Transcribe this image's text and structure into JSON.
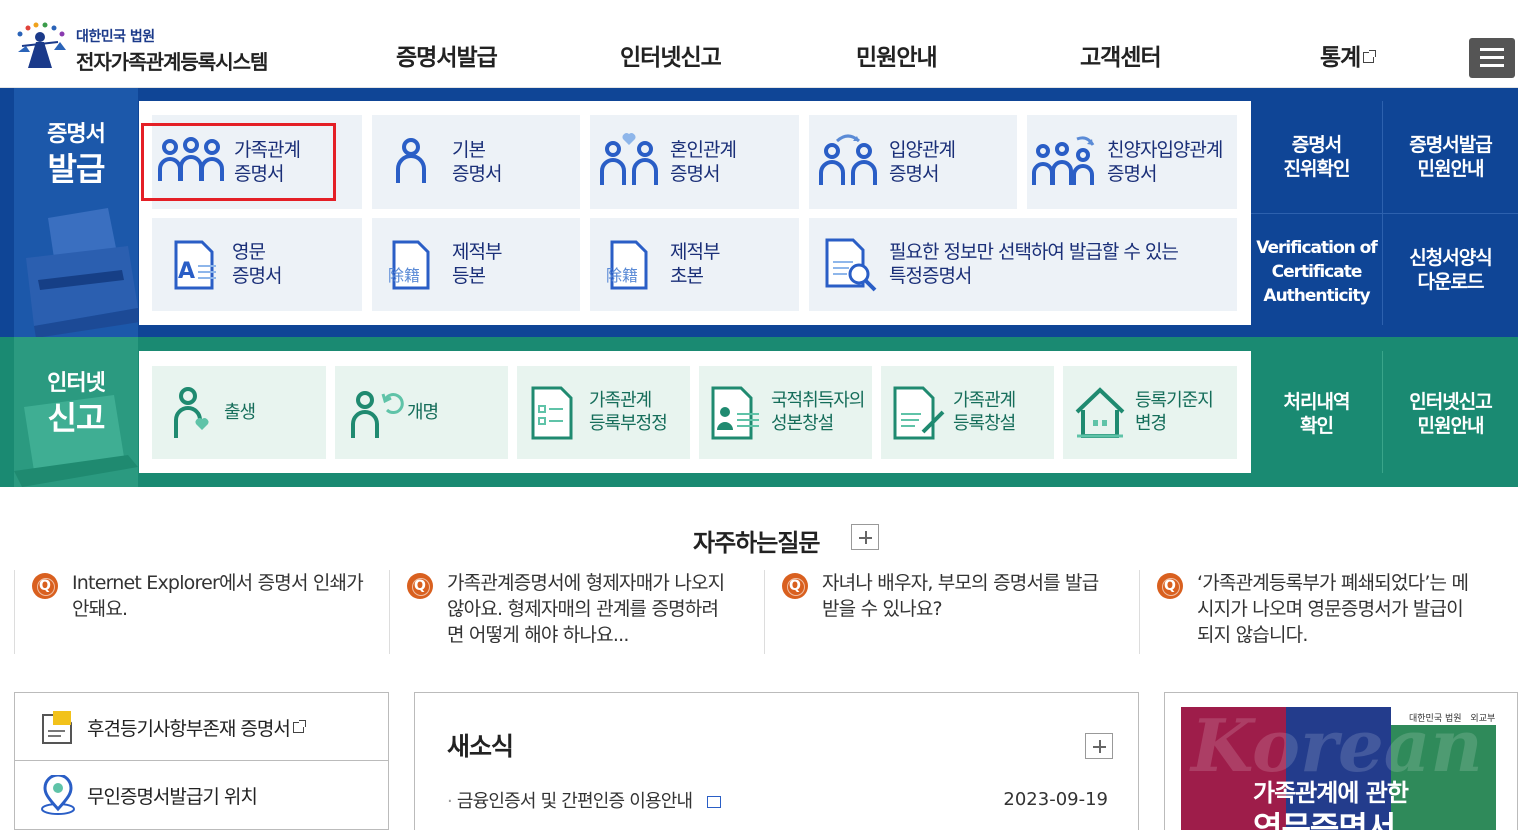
{
  "header": {
    "org_name": "대한민국 법원",
    "site_name": "전자가족관계등록시스템",
    "nav": [
      "증명서발급",
      "인터넷신고",
      "민원안내",
      "고객센터",
      "통계"
    ]
  },
  "cert": {
    "section_small": "증명서",
    "section_big": "발급",
    "tiles": [
      {
        "line1": "가족관계",
        "line2": "증명서",
        "icon": "family-icon"
      },
      {
        "line1": "기본",
        "line2": "증명서",
        "icon": "person-icon"
      },
      {
        "line1": "혼인관계",
        "line2": "증명서",
        "icon": "couple-heart-icon"
      },
      {
        "line1": "입양관계",
        "line2": "증명서",
        "icon": "adoption-icon"
      },
      {
        "line1": "친양자입양관계",
        "line2": "증명서",
        "icon": "family-adoption-icon"
      },
      {
        "line1": "영문",
        "line2": "증명서",
        "icon": "english-document-icon"
      },
      {
        "line1": "제적부",
        "line2": "등본",
        "icon": "document-icon"
      },
      {
        "line1": "제적부",
        "line2": "초본",
        "icon": "document-icon"
      },
      {
        "line1": "필요한 정보만 선택하여 발급할 수 있는",
        "line2": "특정증명서",
        "icon": "search-document-icon"
      }
    ],
    "doc_stamp": "除籍",
    "english_letter": "A",
    "side": [
      {
        "line1": "증명서",
        "line2": "진위확인",
        "line3": ""
      },
      {
        "line1": "증명서발급",
        "line2": "민원안내",
        "line3": ""
      },
      {
        "line1": "Verification of",
        "line2": "Certificate",
        "line3": "Authenticity"
      },
      {
        "line1": "신청서양식",
        "line2": "다운로드",
        "line3": ""
      }
    ]
  },
  "report": {
    "section_small": "인터넷",
    "section_big": "신고",
    "tiles": [
      {
        "line1": "출생",
        "line2": "",
        "icon": "birth-icon"
      },
      {
        "line1": "개명",
        "line2": "",
        "icon": "rename-icon"
      },
      {
        "line1": "가족관계",
        "line2": "등록부정정",
        "icon": "checklist-icon"
      },
      {
        "line1": "국적취득자의",
        "line2": "성본창설",
        "icon": "id-document-icon"
      },
      {
        "line1": "가족관계",
        "line2": "등록창설",
        "icon": "create-document-icon"
      },
      {
        "line1": "등록기준지",
        "line2": "변경",
        "icon": "house-icon"
      }
    ],
    "side": [
      {
        "line1": "처리내역",
        "line2": "확인"
      },
      {
        "line1": "인터넷신고",
        "line2": "민원안내"
      }
    ]
  },
  "faq": {
    "title": "자주하는질문",
    "q_mark": "Q",
    "items": [
      {
        "l1": "Internet Explorer에서 증명서 인쇄가",
        "l2": "안돼요.",
        "l3": ""
      },
      {
        "l1": "가족관계증명서에 형제자매가 나오지",
        "l2": "않아요. 형제자매의 관계를 증명하려",
        "l3": "면 어떻게 해야 하나요..."
      },
      {
        "l1": "자녀나 배우자, 부모의 증명서를 발급",
        "l2": "받을 수 있나요?",
        "l3": ""
      },
      {
        "l1": "‘가족관계등록부가 폐쇄되었다’는 메",
        "l2": "시지가 나오며 영문증명서가 발급이",
        "l3": "되지 않습니다."
      }
    ]
  },
  "quick": {
    "items": [
      "후견등기사항부존재 증명서",
      "무인증명서발급기 위치"
    ]
  },
  "news": {
    "title": "새소식",
    "items": [
      {
        "title": "금융인증서 및 간편인증 이용안내",
        "date": "2023-09-19"
      }
    ]
  },
  "banner": {
    "bg_word": "Korean",
    "line1": "가족관계에 관한",
    "line2": "영문증명서",
    "logo1": "대한민국 법원",
    "logo2": "외교부"
  },
  "colors": {
    "blue_band": "#0f4596",
    "green_band": "#1a8a72",
    "highlight": "#e41f26",
    "faq_q": "#d9601f"
  }
}
